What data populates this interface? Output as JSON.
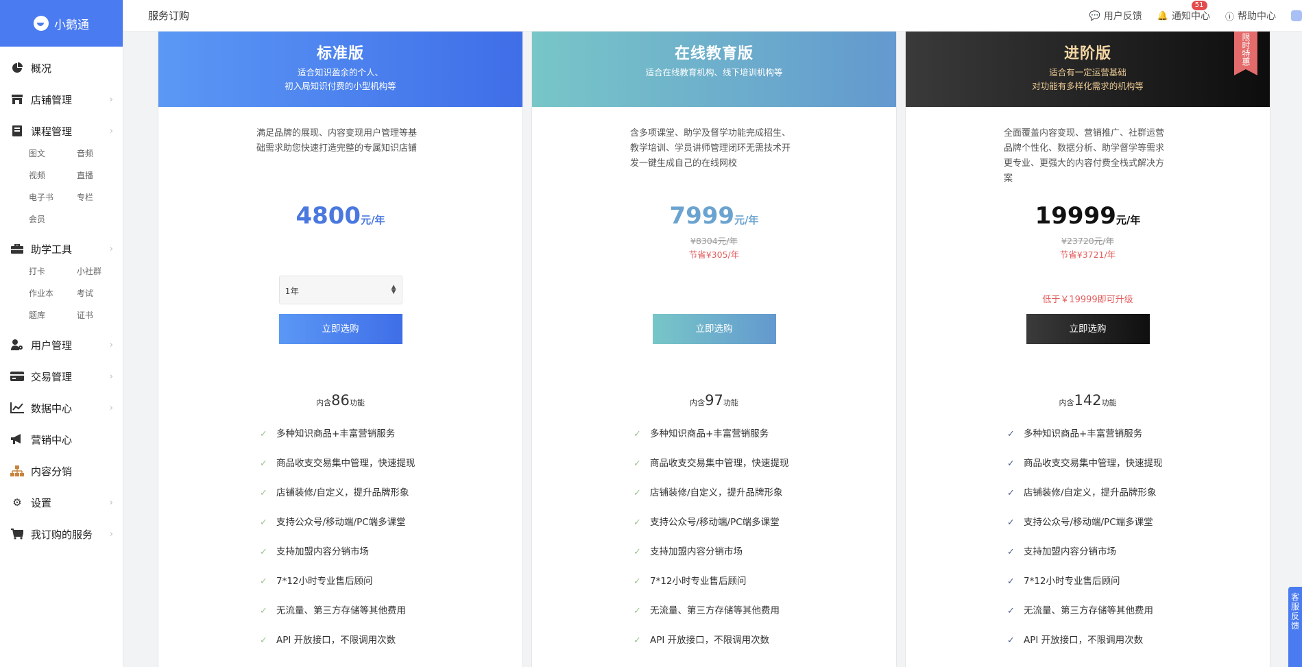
{
  "app": {
    "logo_text": "小鹅通"
  },
  "sidebar": {
    "items": [
      {
        "label": "概况",
        "icon": "pie-chart-icon",
        "has_chevron": false
      },
      {
        "label": "店铺管理",
        "icon": "store-icon",
        "has_chevron": true
      },
      {
        "label": "课程管理",
        "icon": "book-icon",
        "has_chevron": true,
        "sub": [
          "图文",
          "音频",
          "视频",
          "直播",
          "电子书",
          "专栏",
          "会员"
        ]
      },
      {
        "label": "助学工具",
        "icon": "toolbox-icon",
        "has_chevron": true,
        "sub": [
          "打卡",
          "小社群",
          "作业本",
          "考试",
          "题库",
          "证书"
        ]
      },
      {
        "label": "用户管理",
        "icon": "user-gear-icon",
        "has_chevron": true
      },
      {
        "label": "交易管理",
        "icon": "card-icon",
        "has_chevron": true
      },
      {
        "label": "数据中心",
        "icon": "trend-chart-icon",
        "has_chevron": true
      },
      {
        "label": "营销中心",
        "icon": "megaphone-icon",
        "has_chevron": false
      },
      {
        "label": "内容分销",
        "icon": "org-chart-icon",
        "has_chevron": false
      },
      {
        "label": "设置",
        "icon": "gear-icon",
        "has_chevron": true
      },
      {
        "label": "我订购的服务",
        "icon": "cart-icon",
        "has_chevron": true
      }
    ]
  },
  "topbar": {
    "title": "服务订购",
    "feedback": "用户反馈",
    "notifications": "通知中心",
    "notification_count": "51",
    "help": "帮助中心"
  },
  "plans": [
    {
      "name": "标准版",
      "subtitle_lines": [
        "适合知识盈余的个人、",
        "初入局知识付费的小型机构等"
      ],
      "description": "满足品牌的展现、内容变现用户管理等基础需求助您快速打造完整的专属知识店铺",
      "price": "4800",
      "price_unit": "元/年",
      "original_price": "",
      "saving": "",
      "select_value": "1年",
      "upgrade_note": "",
      "buy_label": "立即选购",
      "feature_prefix": "内含",
      "feature_count": "86",
      "feature_suffix": "功能"
    },
    {
      "name": "在线教育版",
      "subtitle_lines": [
        "适合在线教育机构、线下培训机构等"
      ],
      "description": "含多项课堂、助学及督学功能完成招生、教学培训、学员讲师管理闭环无需技术开发一键生成自己的在线网校",
      "price": "7999",
      "price_unit": "元/年",
      "original_price": "¥8304元/年",
      "saving": "节省¥305/年",
      "select_value": "",
      "upgrade_note": "",
      "buy_label": "立即选购",
      "feature_prefix": "内含",
      "feature_count": "97",
      "feature_suffix": "功能"
    },
    {
      "name": "进阶版",
      "ribbon": "限时特惠",
      "subtitle_lines": [
        "适合有一定运营基础",
        "对功能有多样化需求的机构等"
      ],
      "description": "全面覆盖内容变现、营销推广、社群运营品牌个性化、数据分析、助学督学等需求更专业、更强大的内容付费全栈式解决方案",
      "price": "19999",
      "price_unit": "元/年",
      "original_price": "¥23720元/年",
      "saving": "节省¥3721/年",
      "select_value": "",
      "upgrade_note": "低于￥19999即可升级",
      "buy_label": "立即选购",
      "feature_prefix": "内含",
      "feature_count": "142",
      "feature_suffix": "功能"
    }
  ],
  "features": [
    "多种知识商品+丰富营销服务",
    "商品收支交易集中管理，快速提现",
    "店铺装修/自定义，提升品牌形象",
    "支持公众号/移动端/PC端多课堂",
    "支持加盟内容分销市场",
    "7*12小时专业售后顾问",
    "无流量、第三方存储等其他费用",
    "API 开放接口，不限调用次数"
  ],
  "side_tab": {
    "label": "客服反馈"
  },
  "colors": {
    "brand": "#4a7bf0",
    "std_gradient": [
      "#5b98f5",
      "#3f6ee8"
    ],
    "edu_gradient": [
      "#78c6c8",
      "#6399cf"
    ],
    "adv_gradient": [
      "#3a3a3a",
      "#0d0d0d"
    ],
    "discount_red": "#e35d5d"
  }
}
